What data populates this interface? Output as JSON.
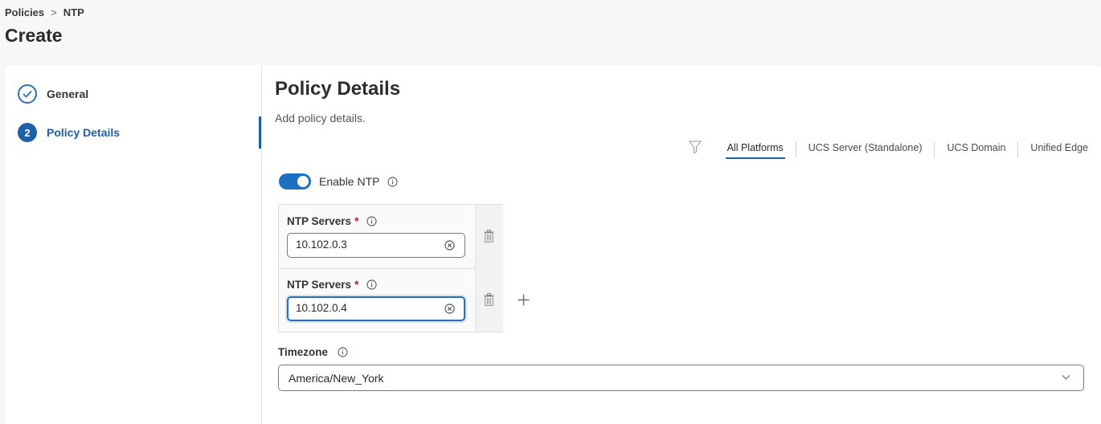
{
  "breadcrumb": {
    "items": [
      "Policies",
      "NTP"
    ],
    "separator": ">"
  },
  "page": {
    "title": "Create"
  },
  "wizard": {
    "steps": [
      {
        "number": "",
        "label": "General",
        "state": "completed",
        "icon": "check-circle-icon"
      },
      {
        "number": "2",
        "label": "Policy Details",
        "state": "active"
      }
    ]
  },
  "section": {
    "title": "Policy Details",
    "subtitle": "Add policy details."
  },
  "platform_filter": {
    "icon": "filter-icon",
    "tabs": [
      "All Platforms",
      "UCS Server (Standalone)",
      "UCS Domain",
      "Unified Edge"
    ],
    "selected": "All Platforms"
  },
  "enable_ntp": {
    "label": "Enable NTP",
    "enabled": true
  },
  "ntp_servers": {
    "label": "NTP Servers",
    "required_mark": "*",
    "entries": [
      "10.102.0.3",
      "10.102.0.4"
    ]
  },
  "timezone": {
    "label": "Timezone",
    "value": "America/New_York"
  },
  "colors": {
    "accent": "#1d5fa8",
    "toggle_on": "#1d6fbf",
    "required": "#c8102e"
  }
}
